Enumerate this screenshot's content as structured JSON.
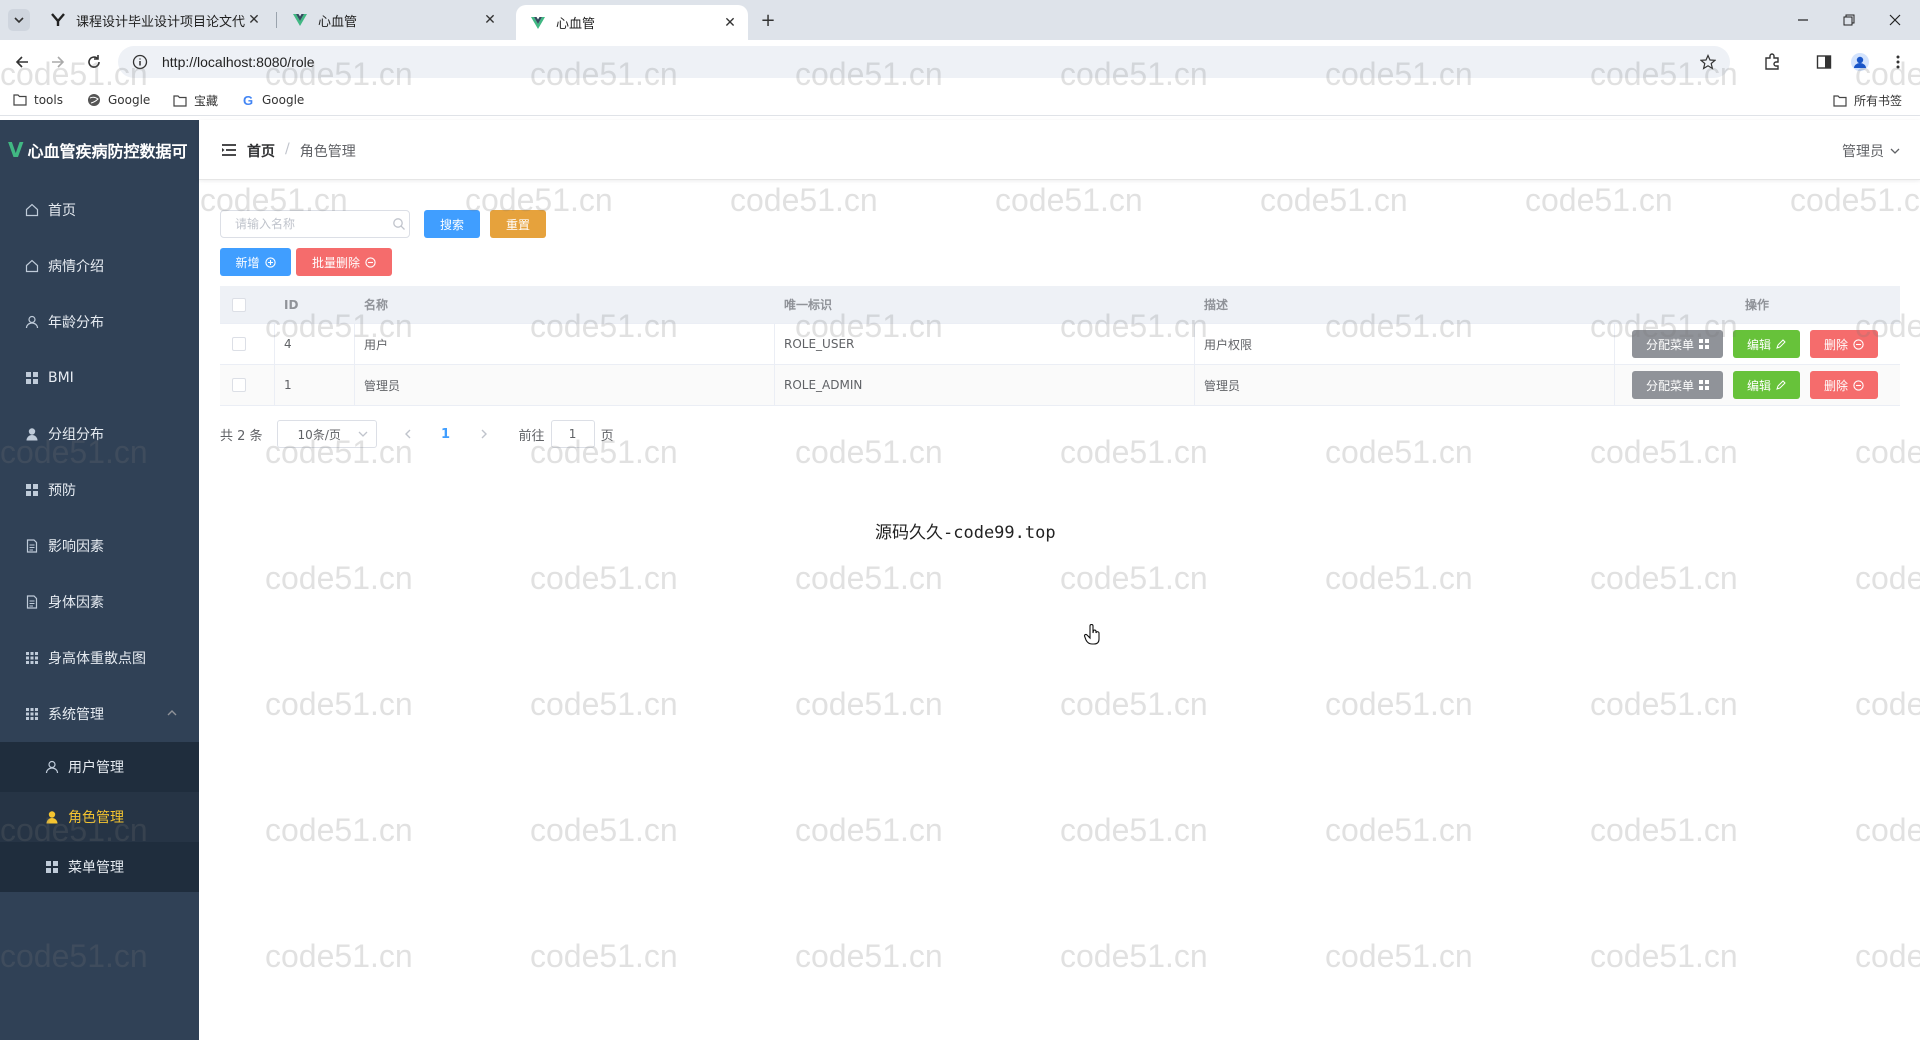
{
  "browser": {
    "tabs": [
      {
        "title": "课程设计毕业设计项目论文代写"
      },
      {
        "title": "心血管"
      },
      {
        "title": "心血管"
      }
    ],
    "url": "http://localhost:8080/role",
    "bookmarks": [
      "tools",
      "Google",
      "宝藏",
      "Google"
    ],
    "all_bookmarks": "所有书签"
  },
  "app": {
    "title": "心血管疾病防控数据可",
    "menu": [
      {
        "label": "首页",
        "icon": "home-icon"
      },
      {
        "label": "病情介绍",
        "icon": "home-icon"
      },
      {
        "label": "年龄分布",
        "icon": "user-icon"
      },
      {
        "label": "BMI",
        "icon": "grid-icon"
      },
      {
        "label": "分组分布",
        "icon": "user-filled-icon"
      },
      {
        "label": "预防",
        "icon": "grid-icon"
      },
      {
        "label": "影响因素",
        "icon": "document-icon"
      },
      {
        "label": "身体因素",
        "icon": "document-icon"
      },
      {
        "label": "身高体重散点图",
        "icon": "grid-icon"
      },
      {
        "label": "系统管理",
        "icon": "grid-icon"
      }
    ],
    "submenu": [
      {
        "label": "用户管理",
        "icon": "user-icon"
      },
      {
        "label": "角色管理",
        "icon": "user-filled-icon"
      },
      {
        "label": "菜单管理",
        "icon": "grid-icon"
      }
    ]
  },
  "header": {
    "breadcrumb_home": "首页",
    "breadcrumb_sep": "/",
    "breadcrumb_current": "角色管理",
    "user": "管理员"
  },
  "toolbar": {
    "search_placeholder": "请输入名称",
    "search_label": "搜索",
    "reset_label": "重置",
    "add_label": "新增",
    "batch_delete_label": "批量删除"
  },
  "table": {
    "headers": {
      "id": "ID",
      "name": "名称",
      "key": "唯一标识",
      "desc": "描述",
      "ops": "操作"
    },
    "rows": [
      {
        "id": "4",
        "name": "用户",
        "key": "ROLE_USER",
        "desc": "用户权限"
      },
      {
        "id": "1",
        "name": "管理员",
        "key": "ROLE_ADMIN",
        "desc": "管理员"
      }
    ],
    "op_labels": {
      "assign": "分配菜单",
      "edit": "编辑",
      "delete": "删除"
    }
  },
  "pagination": {
    "total": "共 2 条",
    "page_size": "10条/页",
    "current_page": "1",
    "goto_prefix": "前往",
    "goto_value": "1",
    "goto_suffix": "页"
  },
  "center_text": "源码久久-code99.top",
  "watermark_text": "code51.cn",
  "colors": {
    "sidebar": "#304156",
    "primary": "#409eff",
    "warning": "#e6a23c",
    "danger": "#f56c6c",
    "success": "#67c23a",
    "info": "#909399",
    "active_menu": "#f4c430"
  }
}
